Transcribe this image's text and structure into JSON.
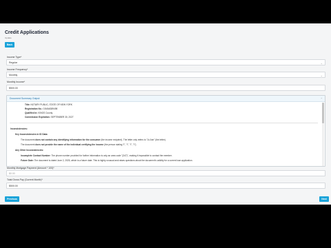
{
  "page": {
    "title": "Credit Applications",
    "subtitle": "Update"
  },
  "toolbar": {
    "back_label": "Back"
  },
  "fields": {
    "income_type": {
      "label": "Income Type*",
      "value": "Regular"
    },
    "income_frequency": {
      "label": "Income Frequency*",
      "value": "Monthly"
    },
    "monthly_income": {
      "label": "Monthly Income*",
      "value": "$500.00"
    },
    "mortgage_payment": {
      "label": "Monthly Mortgage Payment (Amount * 100)*",
      "value": "$0.00"
    },
    "total_gross_pay": {
      "label": "Total Gross Pay (Current Month)*",
      "value": "$500.00"
    }
  },
  "panel": {
    "header": "Document Summary Output",
    "lines": [
      {
        "label": "Title:",
        "text": "NOTARY PUBLIC, STATE OF NEW YORK"
      },
      {
        "label": "Registration No.:",
        "text": "01MA6389498"
      },
      {
        "label": "Qualified in:",
        "text": "KINGS County"
      },
      {
        "label": "Commission Expiration:",
        "text": "SEPTEMBER 30, 2027"
      }
    ],
    "inconsistencies_heading": "Inconsistencies:",
    "key_heading": "Key Inconsistencies in ID Data:",
    "key_items": [
      {
        "prefix": "The document",
        "bold": "does not contain any identifying information for the consumer",
        "suffix": "(the income recipient). The letter only refers to \"Jo Ann\" (the letter)."
      },
      {
        "prefix": "The document",
        "bold": "does not provide the name of the individual certifying the income",
        "suffix": "(the person stating \"I\", \"I\", \"I\", \"I\")."
      }
    ],
    "other_heading": "Any Other Inconsistencies:",
    "other_items": [
      {
        "bold": "Incomplete Contact Number:",
        "text": "The phone number provided for further information is only an area code \"(347)\", making it impossible to contact the member."
      },
      {
        "bold": "Future Date:",
        "text": "The document is dated June 2, 2025, which is a future date. This is highly unusual and raises questions about the document's validity for a current loan application."
      }
    ]
  },
  "footer": {
    "previous_label": "Previous",
    "next_label": "Next"
  }
}
